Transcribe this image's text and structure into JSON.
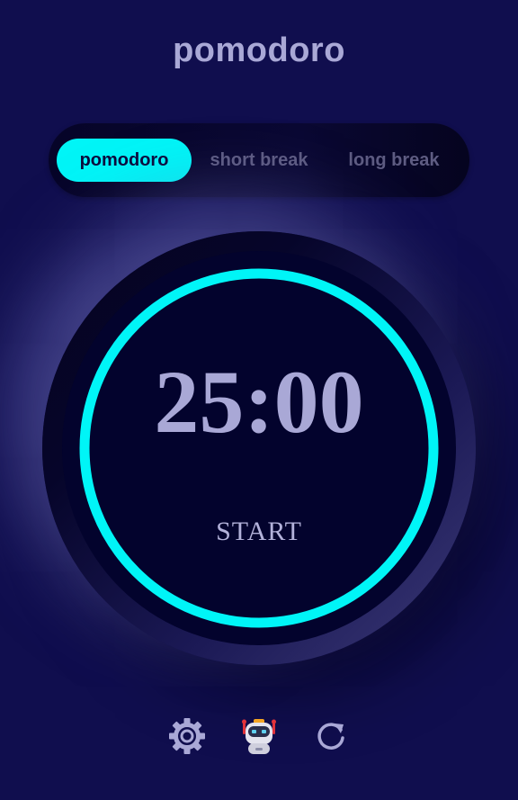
{
  "header": {
    "title": "pomodoro"
  },
  "tabs": [
    {
      "label": "pomodoro",
      "active": true
    },
    {
      "label": "short break",
      "active": false
    },
    {
      "label": "long break",
      "active": false
    }
  ],
  "timer": {
    "time": "25:00",
    "action_label": "START",
    "progress_fraction": 1.0
  },
  "toolbar": {
    "icons": [
      "gear-icon",
      "robot-icon",
      "refresh-icon"
    ]
  },
  "colors": {
    "background": "#100e4e",
    "accent": "#00f5f7",
    "text": "#a9a8d6",
    "clock_face": "#03032d"
  }
}
